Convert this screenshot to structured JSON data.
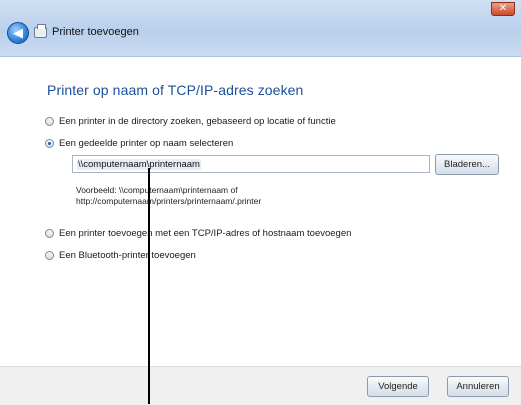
{
  "window": {
    "title": "Printer toevoegen",
    "close_glyph": "✕",
    "back_glyph": "◀"
  },
  "main": {
    "heading": "Printer op naam of TCP/IP-adres zoeken",
    "options": [
      {
        "label": "Een printer in de directory zoeken, gebaseerd op locatie of functie",
        "checked": false
      },
      {
        "label": "Een gedeelde printer op naam selecteren",
        "checked": true
      },
      {
        "label": "Een printer toevoegen met een TCP/IP-adres of hostnaam toevoegen",
        "checked": false
      },
      {
        "label": "Een Bluetooth-printer toevoegen",
        "checked": false
      }
    ],
    "printer_name_input": "\\\\computernaam\\printernaam",
    "browse_label": "Bladeren...",
    "example_line1": "Voorbeeld: \\\\computernaam\\printernaam of",
    "example_line2": "http://computernaam/printers/printernaam/.printer"
  },
  "footer": {
    "next_label": "Volgende",
    "cancel_label": "Annuleren"
  },
  "colors": {
    "heading": "#1b4f9a",
    "header_band": "#c4d9f0",
    "close_button": "#c9492b"
  },
  "icons": [
    "back-arrow-icon",
    "printer-icon",
    "close-icon"
  ]
}
